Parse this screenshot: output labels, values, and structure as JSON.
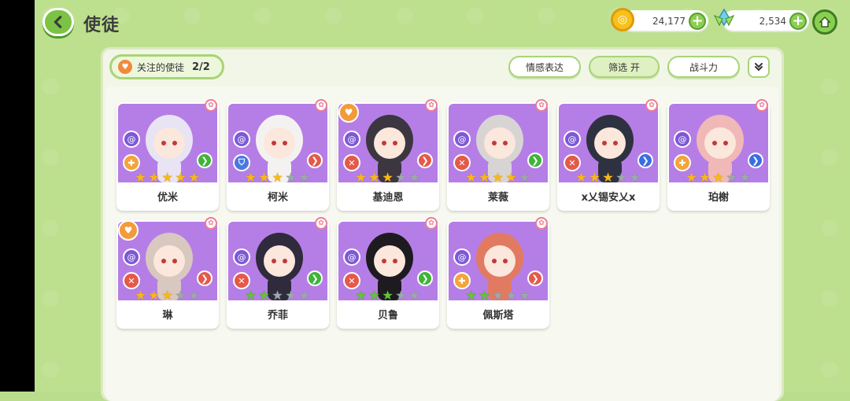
{
  "header": {
    "title": "使徒"
  },
  "resources": {
    "coins": "24,177",
    "gems": "2,534"
  },
  "toolbar": {
    "follow_label": "关注的使徒",
    "follow_count": "2/2",
    "emotion_label": "情感表达",
    "filter_label": "筛选 开",
    "power_label": "战斗力"
  },
  "colors": {
    "card_background": "#b57ee6",
    "role_red": "#e35a4a",
    "role_orange": "#f3a43a",
    "role_blue": "#4a78e0",
    "arrow_green": "#3fb43a",
    "arrow_red": "#e35a4a",
    "arrow_blue": "#3a6fe0"
  },
  "apostles": [
    {
      "name": "优米",
      "favorite": false,
      "element_icon": "swirl-icon",
      "role_icon": "cross-icon",
      "role_color": "#f3a43a",
      "arrow_color": "#3fb43a",
      "stars": [
        "gold",
        "gold",
        "gold",
        "gold",
        "gold"
      ],
      "char_color": "#e8e4f4"
    },
    {
      "name": "柯米",
      "favorite": false,
      "element_icon": "swirl-icon",
      "role_icon": "shield-icon",
      "role_color": "#4a78e0",
      "arrow_color": "#e35a4a",
      "stars": [
        "gold",
        "gold",
        "gold",
        "empty",
        "empty"
      ],
      "char_color": "#f4f2f0"
    },
    {
      "name": "基迪恩",
      "favorite": true,
      "element_icon": "swirl-icon",
      "role_icon": "swords-icon",
      "role_color": "#e35a4a",
      "arrow_color": "#e35a4a",
      "stars": [
        "gold",
        "gold",
        "gold",
        "empty",
        "empty"
      ],
      "char_color": "#3b3640"
    },
    {
      "name": "莱薇",
      "favorite": false,
      "element_icon": "swirl-icon",
      "role_icon": "swords-icon",
      "role_color": "#e35a4a",
      "arrow_color": "#3fb43a",
      "stars": [
        "gold",
        "gold",
        "gold",
        "gold",
        "empty"
      ],
      "char_color": "#d8d4d4"
    },
    {
      "name": "x乂锡安乂x",
      "favorite": false,
      "element_icon": "swirl-icon",
      "role_icon": "swords-icon",
      "role_color": "#e35a4a",
      "arrow_color": "#3a6fe0",
      "stars": [
        "gold",
        "gold",
        "gold",
        "empty",
        "empty"
      ],
      "char_color": "#2e3240"
    },
    {
      "name": "珀榭",
      "favorite": false,
      "element_icon": "swirl-icon",
      "role_icon": "cross-icon",
      "role_color": "#f3a43a",
      "arrow_color": "#3a6fe0",
      "stars": [
        "gold",
        "gold",
        "gold",
        "empty",
        "empty"
      ],
      "char_color": "#f1b8b8"
    },
    {
      "name": "琳",
      "favorite": true,
      "element_icon": "swirl-icon",
      "role_icon": "swords-icon",
      "role_color": "#e35a4a",
      "arrow_color": "#e35a4a",
      "stars": [
        "gold",
        "gold",
        "gold",
        "empty",
        "empty"
      ],
      "char_color": "#d9c8c0"
    },
    {
      "name": "乔菲",
      "favorite": false,
      "element_icon": "swirl-icon",
      "role_icon": "swords-icon",
      "role_color": "#e35a4a",
      "arrow_color": "#3fb43a",
      "stars": [
        "green",
        "green",
        "empty",
        "empty",
        "empty"
      ],
      "char_color": "#2f2a3c"
    },
    {
      "name": "贝鲁",
      "favorite": false,
      "element_icon": "swirl-icon",
      "role_icon": "swords-icon",
      "role_color": "#e35a4a",
      "arrow_color": "#3fb43a",
      "stars": [
        "green",
        "green",
        "green",
        "empty",
        "empty"
      ],
      "char_color": "#1d1b20"
    },
    {
      "name": "佩斯塔",
      "favorite": false,
      "element_icon": "swirl-icon",
      "role_icon": "cross-icon",
      "role_color": "#f3a43a",
      "arrow_color": "#e35a4a",
      "stars": [
        "green",
        "green",
        "empty",
        "empty",
        "empty"
      ],
      "char_color": "#e27a62"
    }
  ]
}
